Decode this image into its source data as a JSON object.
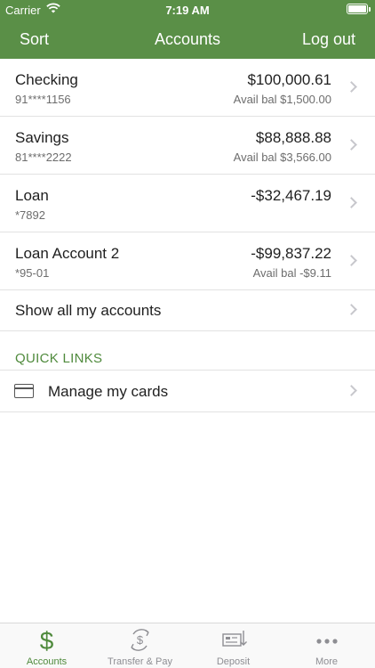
{
  "status": {
    "carrier": "Carrier",
    "time": "7:19 AM",
    "wifi_icon": "wifi-icon",
    "battery_icon": "battery-icon"
  },
  "nav": {
    "left": "Sort",
    "title": "Accounts",
    "right": "Log out"
  },
  "accounts": [
    {
      "name": "Checking",
      "number": "91****1156",
      "amount": "$100,000.61",
      "avail": "Avail bal $1,500.00"
    },
    {
      "name": "Savings",
      "number": "81****2222",
      "amount": "$88,888.88",
      "avail": "Avail bal $3,566.00"
    },
    {
      "name": "Loan",
      "number": "*7892",
      "amount": "-$32,467.19",
      "avail": ""
    },
    {
      "name": "Loan Account 2",
      "number": "*95-01",
      "amount": "-$99,837.22",
      "avail": "Avail bal -$9.11"
    }
  ],
  "show_all": "Show all my accounts",
  "quick_links": {
    "title": "QUICK LINKS",
    "items": [
      {
        "label": "Manage my cards",
        "icon": "credit-card-icon"
      }
    ]
  },
  "tabs": [
    {
      "label": "Accounts",
      "icon": "dollar-icon",
      "active": true
    },
    {
      "label": "Transfer & Pay",
      "icon": "transfer-icon",
      "active": false
    },
    {
      "label": "Deposit",
      "icon": "check-deposit-icon",
      "active": false
    },
    {
      "label": "More",
      "icon": "more-dots-icon",
      "active": false
    }
  ],
  "colors": {
    "brand_green": "#5a8f47",
    "accent_green": "#4f8a3c",
    "tab_inactive": "#8e8e93"
  }
}
